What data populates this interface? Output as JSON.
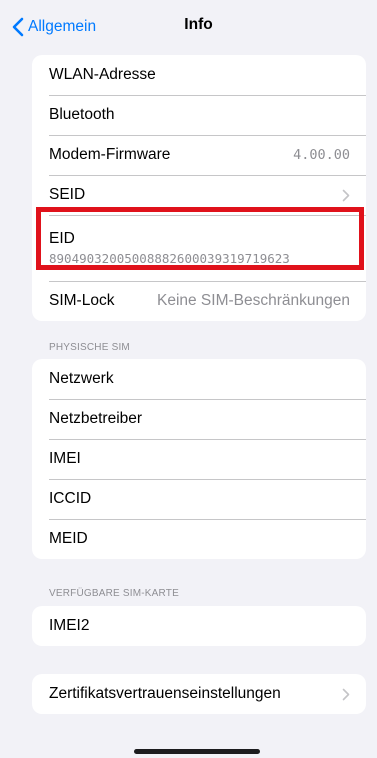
{
  "nav": {
    "back_label": "Allgemein",
    "title": "Info"
  },
  "group1": {
    "wlan_label": "WLAN-Adresse",
    "bluetooth_label": "Bluetooth",
    "modem_label": "Modem-Firmware",
    "modem_value": "4.00.00",
    "seid_label": "SEID",
    "eid_label": "EID",
    "eid_value": "89049032005008882600039319719623",
    "simlock_label": "SIM-Lock",
    "simlock_value": "Keine SIM-Beschränkungen"
  },
  "physical_sim": {
    "header": "PHYSISCHE SIM",
    "network_label": "Netzwerk",
    "carrier_label": "Netzbetreiber",
    "imei_label": "IMEI",
    "iccid_label": "ICCID",
    "meid_label": "MEID"
  },
  "available_sim": {
    "header": "VERFÜGBARE SIM-KARTE",
    "imei2_label": "IMEI2"
  },
  "certificates": {
    "label": "Zertifikatsvertrauenseinstellungen"
  },
  "colors": {
    "accent": "#007aff",
    "highlight": "#e0121b",
    "background": "#f2f2f7",
    "secondary_text": "#8e8e93"
  },
  "icons": {
    "back": "chevron-left-icon",
    "disclosure": "chevron-right-icon"
  }
}
